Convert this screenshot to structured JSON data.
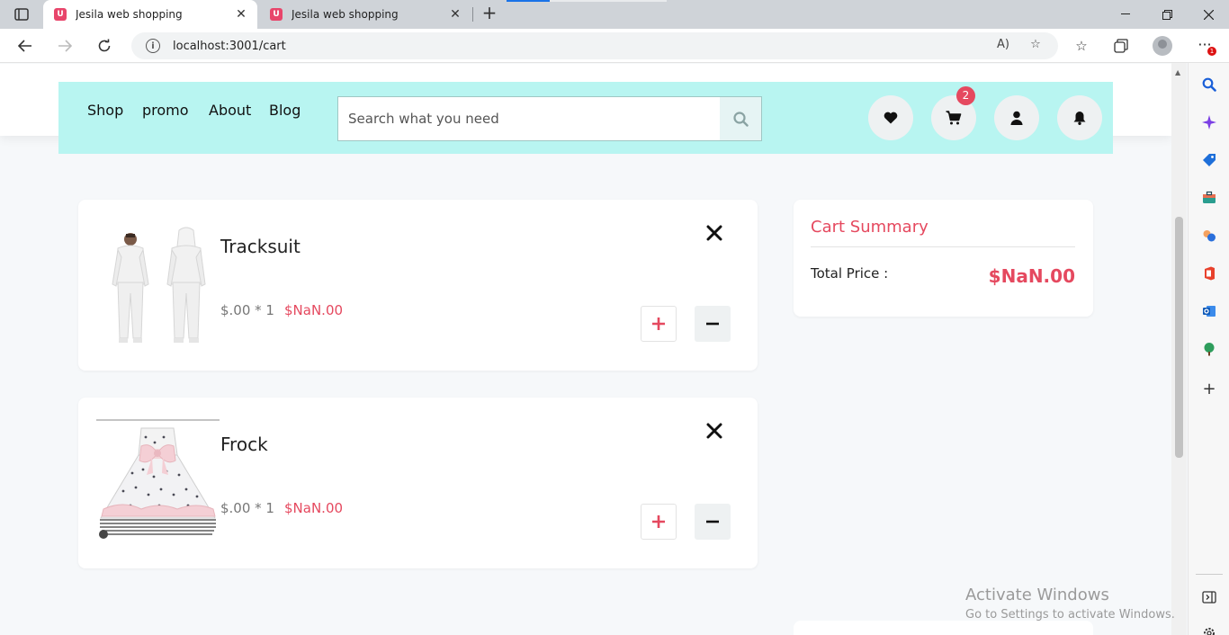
{
  "browser": {
    "tabs": [
      {
        "title": "Jesila web shopping",
        "active": true
      },
      {
        "title": "Jesila web shopping",
        "active": false
      }
    ],
    "url": "localhost:3001/cart",
    "profile_notification_count": "1"
  },
  "nav": {
    "links": [
      "Shop",
      "promo",
      "About",
      "Blog"
    ]
  },
  "search": {
    "placeholder": "Search what you need"
  },
  "header_icons": {
    "cart_badge": "2"
  },
  "cart": {
    "items": [
      {
        "name": "Tracksuit",
        "unit": "$.00 * 1",
        "total": "$NaN.00",
        "image_icon": "tracksuit-photo"
      },
      {
        "name": "Frock",
        "unit": "$.00 * 1",
        "total": "$NaN.00",
        "image_icon": "frock-photo"
      }
    ]
  },
  "summary": {
    "title": "Cart Summary",
    "total_label": "Total Price :",
    "total_value": "$NaN.00"
  },
  "watermark": {
    "line1": "Activate Windows",
    "line2": "Go to Settings to activate Windows."
  },
  "colors": {
    "header_bg": "#b8f5f1",
    "accent": "#e5495f",
    "page_bg": "#f6f8fa"
  }
}
